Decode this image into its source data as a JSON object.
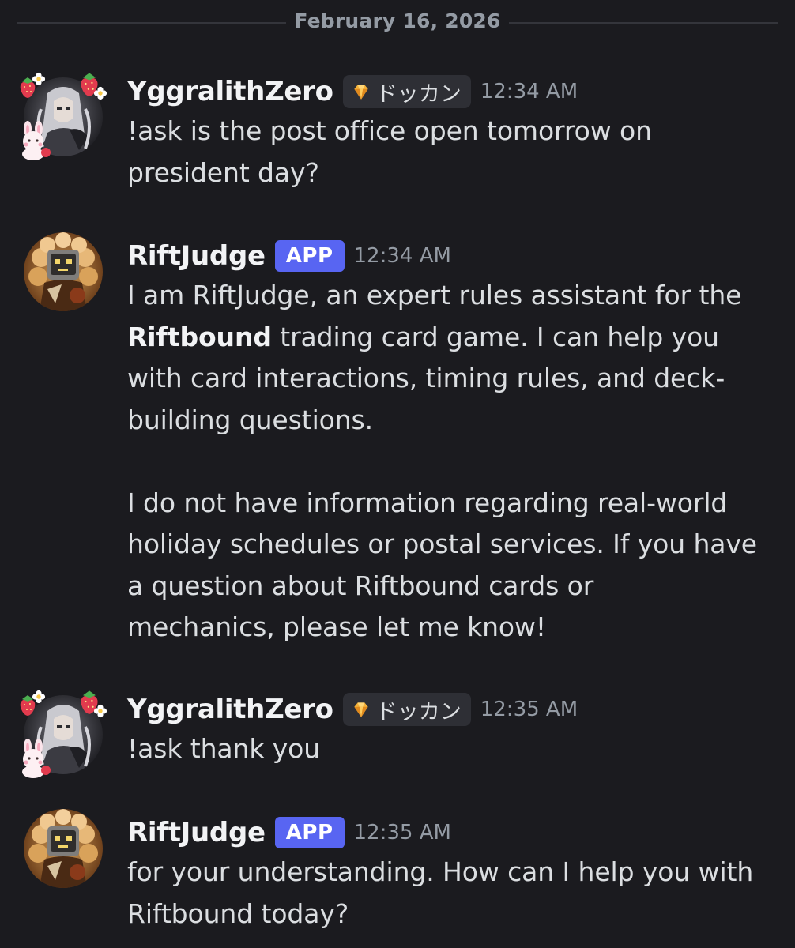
{
  "date_divider": "February 16, 2026",
  "messages": [
    {
      "username": "YggralithZero",
      "tag": "ドッカン",
      "timestamp": "12:34 AM",
      "lines": [
        "!ask is the post office open tomorrow on",
        "president day?"
      ]
    },
    {
      "username": "RiftJudge",
      "badge": "APP",
      "timestamp": "12:34 AM",
      "p1_l1": "I am RiftJudge, an expert rules assistant for the",
      "p1_l2_bold": "Riftbound",
      "p1_l2_rest": " trading card game. I can help you",
      "p1_l3": "with card interactions, timing rules, and deck-",
      "p1_l4": "building questions.",
      "p2_l1": "I do not have information regarding real-world",
      "p2_l2": "holiday schedules or postal services. If you have",
      "p2_l3": "a question about Riftbound cards or",
      "p2_l4": "mechanics, please let me know!"
    },
    {
      "username": "YggralithZero",
      "tag": "ドッカン",
      "timestamp": "12:35 AM",
      "lines": [
        "!ask thank you"
      ]
    },
    {
      "username": "RiftJudge",
      "badge": "APP",
      "timestamp": "12:35 AM",
      "lines": [
        "for your understanding. How can I help you with",
        "Riftbound today?"
      ]
    }
  ],
  "colors": {
    "background": "#1b1b1f",
    "username": "#f2f3f5",
    "message_text": "#dbdee1",
    "timestamp": "#949ba4",
    "app_badge": "#5865f2",
    "role_tag_bg": "#2e2f35"
  },
  "icons": {
    "role_tag_icon": "gem-icon",
    "user_avatar": "yggralith-avatar",
    "bot_avatar": "riftjudge-avatar"
  }
}
